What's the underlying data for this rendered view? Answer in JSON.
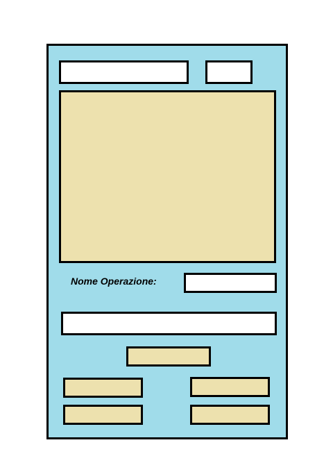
{
  "form": {
    "top_field_left": {
      "value": ""
    },
    "top_field_right": {
      "value": ""
    },
    "operation_name_label": "Nome Operazione:",
    "operation_name_input": {
      "value": ""
    },
    "wide_input": {
      "value": ""
    },
    "center_button_label": "",
    "grid_buttons": [
      "",
      "",
      "",
      ""
    ]
  },
  "colors": {
    "panel_background": "#a0dcea",
    "field_background": "#ffffff",
    "button_background": "#ede1ae",
    "display_background": "#ede1ae",
    "border": "#000000"
  }
}
